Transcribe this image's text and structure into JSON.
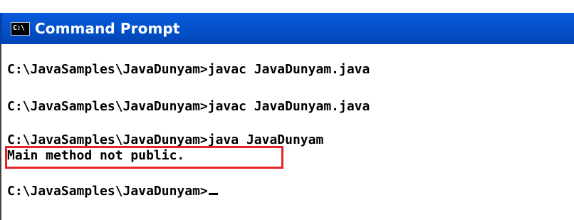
{
  "window": {
    "title": "Command Prompt",
    "icon_glyph": "C:\\",
    "icon_name": "console-icon"
  },
  "console": {
    "lines": [
      "C:\\JavaSamples\\JavaDunyam>javac JavaDunyam.java",
      "",
      "C:\\JavaSamples\\JavaDunyam>javac JavaDunyam.java",
      "",
      "C:\\JavaSamples\\JavaDunyam>java JavaDunyam",
      "Main method not public.",
      "",
      "C:\\JavaSamples\\JavaDunyam>"
    ]
  },
  "colors": {
    "titlebar": "#0350c8",
    "background": "#ffffff",
    "text": "#000000",
    "highlight_border": "#e4232a"
  }
}
